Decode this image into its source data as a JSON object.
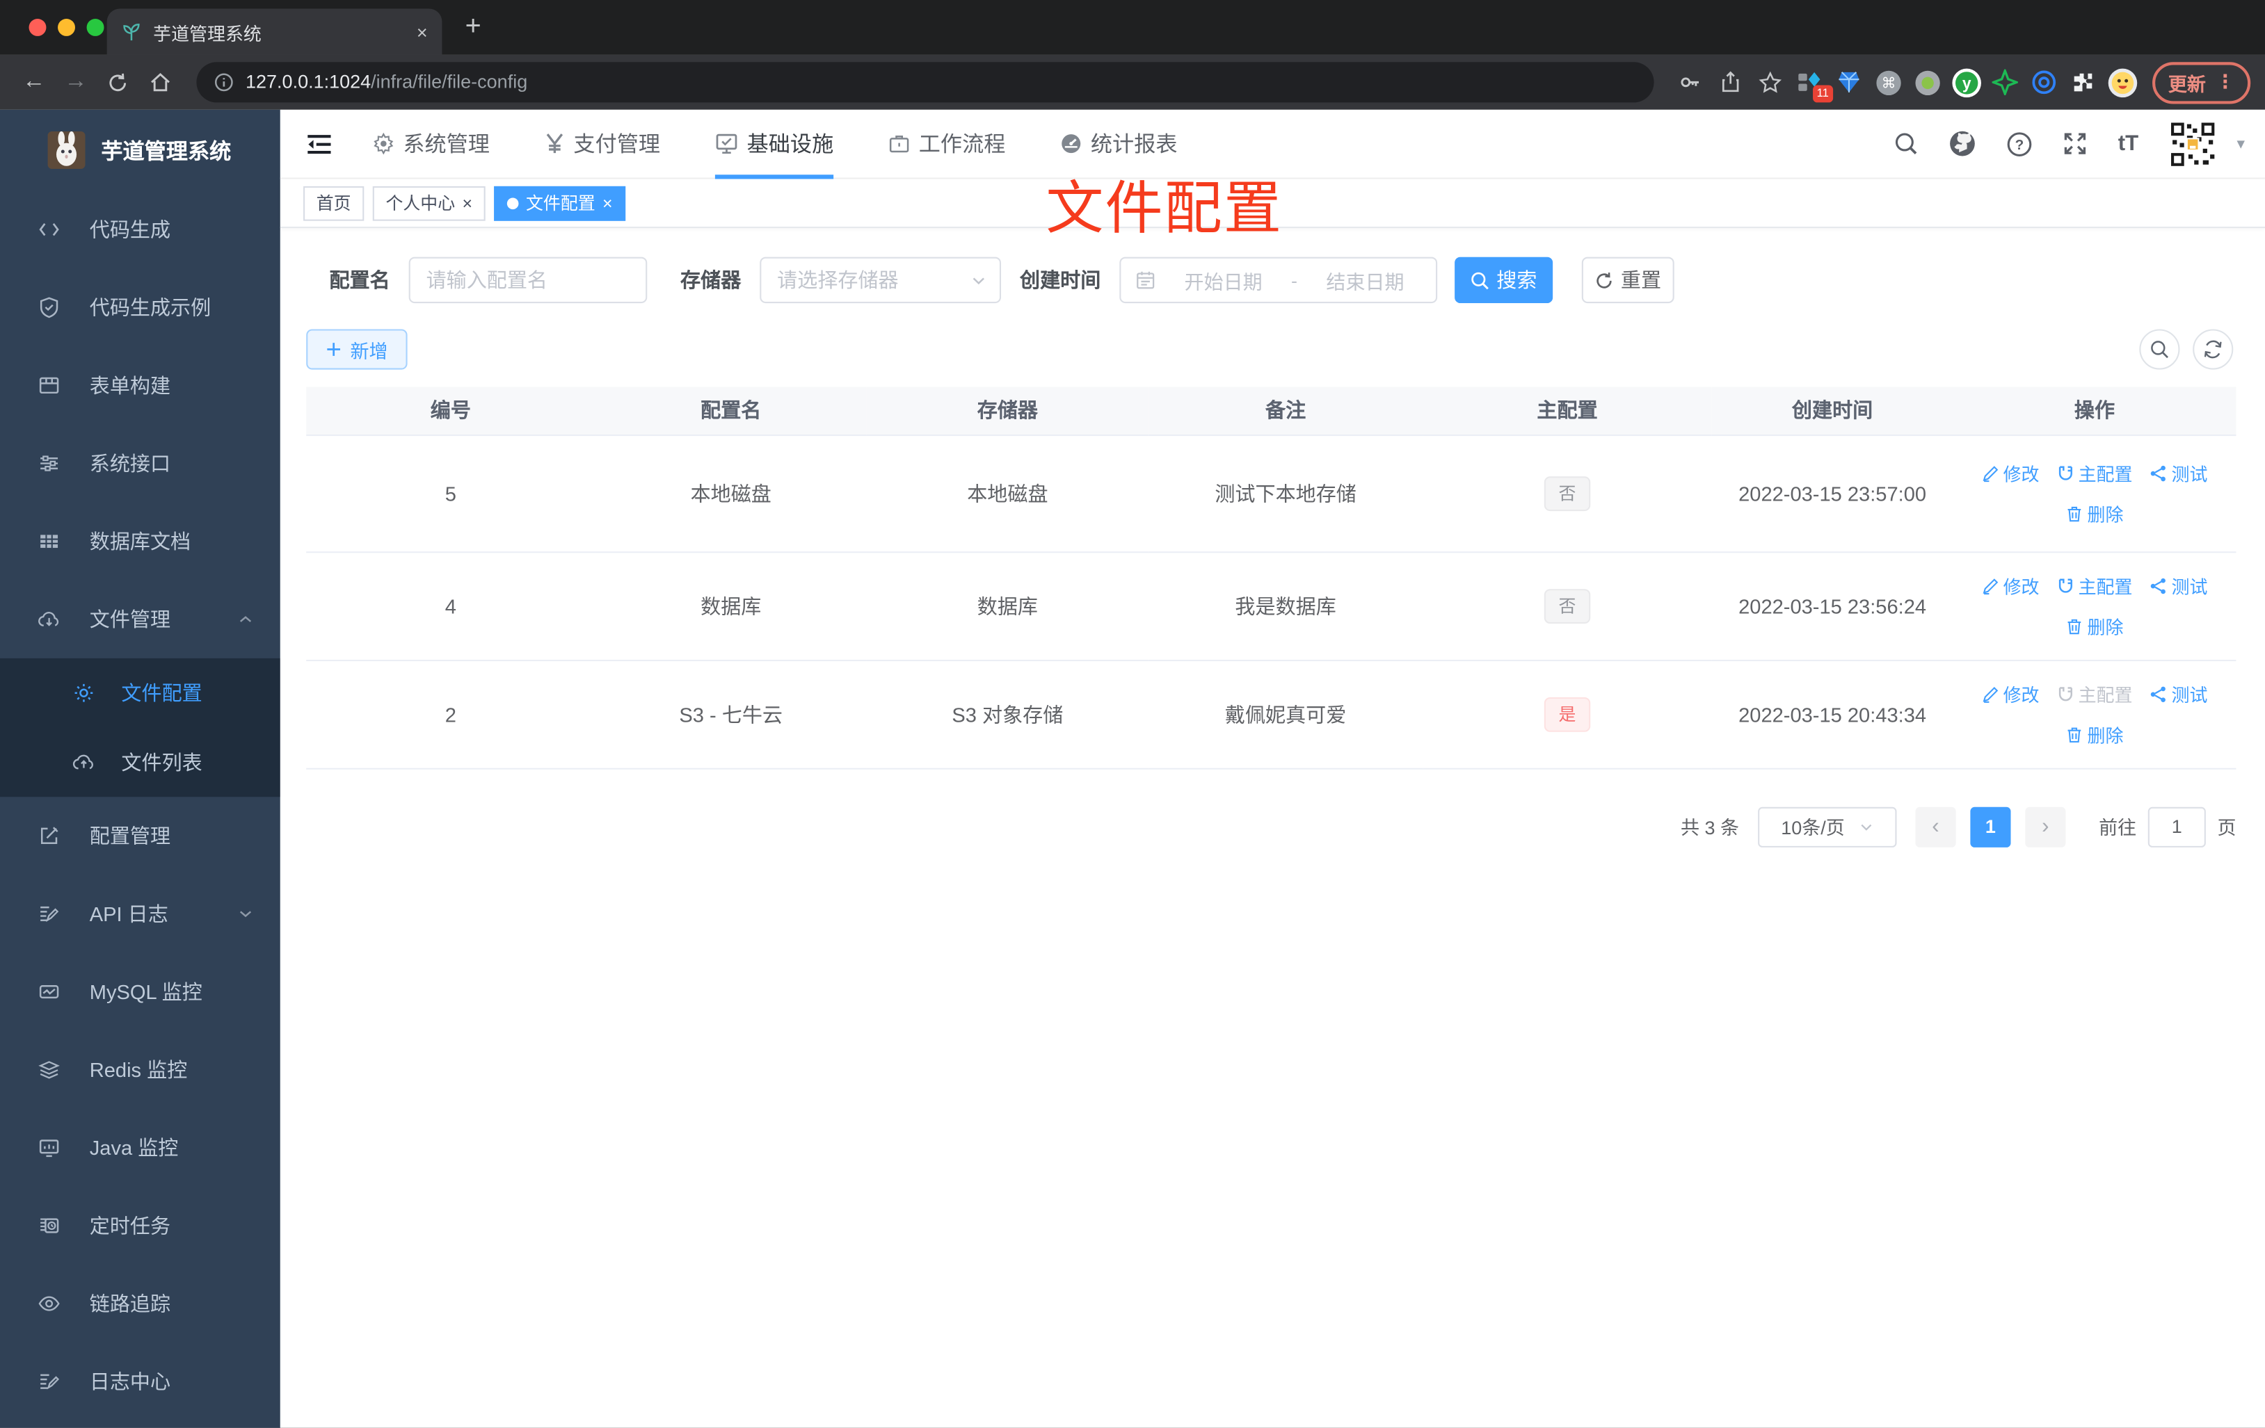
{
  "browser": {
    "tab_title": "芋道管理系统",
    "close_glyph": "×",
    "newtab_glyph": "+",
    "back_glyph": "←",
    "forward_glyph": "→",
    "url_host": "127.0.0.1:1024",
    "url_path": "/infra/file/file-config",
    "ext_badge": "11",
    "cmd_glyph": "⌘",
    "update_label": "更新",
    "menu_dots": "⋮"
  },
  "sidebar": {
    "app_title": "芋道管理系统",
    "items": [
      "代码生成",
      "代码生成示例",
      "表单构建",
      "系统接口",
      "数据库文档",
      "文件管理",
      "配置管理",
      "API 日志",
      "MySQL 监控",
      "Redis 监控",
      "Java 监控",
      "定时任务",
      "链路追踪",
      "日志中心"
    ],
    "submenu": [
      "文件配置",
      "文件列表"
    ]
  },
  "topnav": {
    "items": [
      "系统管理",
      "支付管理",
      "基础设施",
      "工作流程",
      "统计报表"
    ],
    "help_glyph": "?",
    "fontsize_glyph": "tT",
    "caret_glyph": "▾"
  },
  "tabs": [
    "首页",
    "个人中心",
    "文件配置"
  ],
  "annotation": "文件配置",
  "filters": {
    "name_label": "配置名",
    "name_placeholder": "请输入配置名",
    "storage_label": "存储器",
    "storage_placeholder": "请选择存储器",
    "time_label": "创建时间",
    "start_placeholder": "开始日期",
    "range_sep": "-",
    "end_placeholder": "结束日期",
    "search_label": "搜索",
    "reset_label": "重置"
  },
  "toolbar": {
    "add_label": "新增"
  },
  "table": {
    "columns": [
      "编号",
      "配置名",
      "存储器",
      "备注",
      "主配置",
      "创建时间",
      "操作"
    ],
    "rows": [
      {
        "id": "5",
        "name": "本地磁盘",
        "storage": "本地磁盘",
        "remark": "测试下本地存储",
        "master": "否",
        "time": "2022-03-15 23:57:00"
      },
      {
        "id": "4",
        "name": "数据库",
        "storage": "数据库",
        "remark": "我是数据库",
        "master": "否",
        "time": "2022-03-15 23:56:24"
      },
      {
        "id": "2",
        "name": "S3 - 七牛云",
        "storage": "S3 对象存储",
        "remark": "戴佩妮真可爱",
        "master": "是",
        "time": "2022-03-15 20:43:34"
      }
    ]
  },
  "actions": {
    "edit": "修改",
    "master": "主配置",
    "test": "测试",
    "del": "删除"
  },
  "pagination": {
    "total": "共 3 条",
    "page_size": "10条/页",
    "prev": "‹",
    "next": "›",
    "current": "1",
    "goto_label": "前往",
    "goto_value": "1",
    "unit": "页"
  },
  "colors": {
    "accent": "#409EFF",
    "annotation_red": "#F53B1D",
    "sidebar_bg": "#304156",
    "submenu_bg": "#1F2D3D",
    "tag_no": "#909399",
    "tag_yes": "#F56C6C"
  }
}
